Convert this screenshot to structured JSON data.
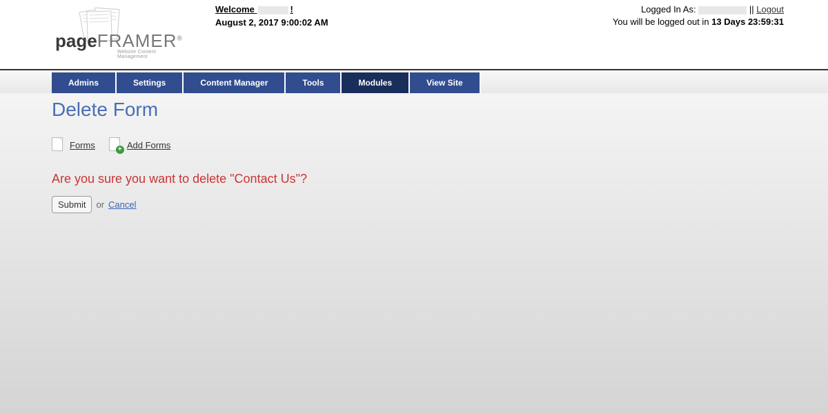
{
  "header": {
    "welcome_prefix": "Welcome",
    "welcome_suffix": "!",
    "date": "August 2, 2017 9:00:02 AM",
    "logged_in_prefix": "Logged In As:",
    "separator": "||",
    "logout": "Logout",
    "countdown_prefix": "You will be logged out in",
    "countdown_value": "13 Days 23:59:31",
    "logo_page": "page",
    "logo_framer": "FRAMER",
    "logo_tagline": "Website Content Management"
  },
  "nav": {
    "items": [
      {
        "label": "Admins",
        "active": false
      },
      {
        "label": "Settings",
        "active": false
      },
      {
        "label": "Content Manager",
        "active": false
      },
      {
        "label": "Tools",
        "active": false
      },
      {
        "label": "Modules",
        "active": true
      },
      {
        "label": "View Site",
        "active": false
      }
    ]
  },
  "page": {
    "title": "Delete Form",
    "breadcrumbs": {
      "forms": "Forms",
      "add_forms": "Add Forms"
    },
    "confirm_message": "Are you sure you want to delete \"Contact Us\"?",
    "submit_label": "Submit",
    "or_label": "or",
    "cancel_label": "Cancel"
  }
}
